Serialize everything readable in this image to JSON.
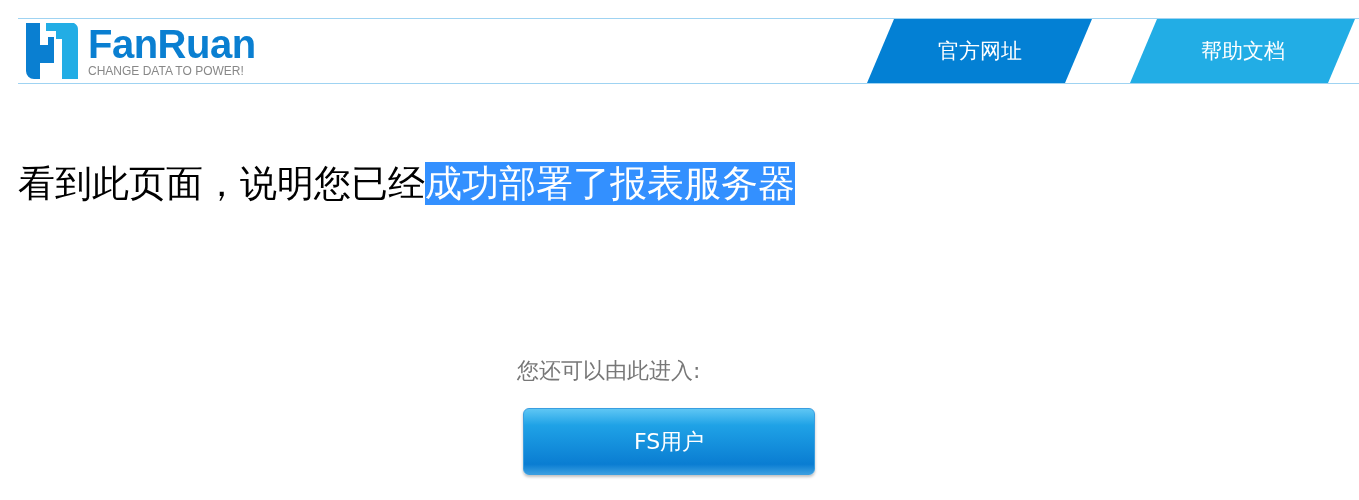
{
  "header": {
    "logo": {
      "name": "FanRuan",
      "slogan": "CHANGE DATA TO POWER!"
    },
    "links": [
      {
        "label": "官方网址",
        "color": "#0380d4"
      },
      {
        "label": "帮助文档",
        "color": "#22ade5"
      }
    ]
  },
  "headline": {
    "parts": [
      {
        "text": "看到此页面，说明您已经",
        "highlighted": false
      },
      {
        "text": "成功部署了报表服务器",
        "highlighted": true
      }
    ]
  },
  "prompt": "您还可以由此进入:",
  "button": "FS用户"
}
